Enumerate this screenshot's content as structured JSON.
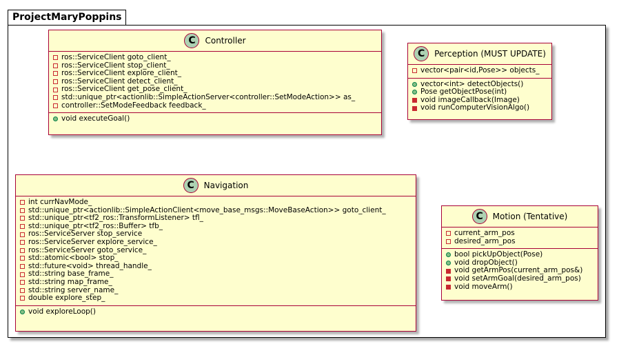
{
  "package": {
    "name": "ProjectMaryPoppins"
  },
  "classes": {
    "controller": {
      "stereotype": "C",
      "name": "Controller",
      "fields": [
        {
          "vis": "private",
          "text": "ros::ServiceClient goto_client_"
        },
        {
          "vis": "private",
          "text": "ros::ServiceClient stop_client_"
        },
        {
          "vis": "private",
          "text": "ros::ServiceClient explore_client_"
        },
        {
          "vis": "private",
          "text": "ros::ServiceClient detect_client_"
        },
        {
          "vis": "private",
          "text": "ros::ServiceClient get_pose_client_"
        },
        {
          "vis": "private",
          "text": "std::unique_ptr<actionlib::SimpleActionServer<controller::SetModeAction>> as_"
        },
        {
          "vis": "private",
          "text": "controller::SetModeFeedback feedback_"
        }
      ],
      "methods": [
        {
          "vis": "public",
          "text": "void executeGoal()"
        }
      ]
    },
    "perception": {
      "stereotype": "C",
      "name": "Perception (MUST UPDATE)",
      "fields": [
        {
          "vis": "private",
          "text": "vector<pair<id,Pose>> objects_"
        }
      ],
      "methods": [
        {
          "vis": "public",
          "text": "vector<int> detectObjects()"
        },
        {
          "vis": "public",
          "text": "Pose getObjectPose(int)"
        },
        {
          "vis": "private",
          "text": "void imageCallback(Image)"
        },
        {
          "vis": "private",
          "text": "void runComputerVisionAlgo()"
        }
      ]
    },
    "navigation": {
      "stereotype": "C",
      "name": "Navigation",
      "fields": [
        {
          "vis": "private",
          "text": "int currNavMode_"
        },
        {
          "vis": "private",
          "text": "std::unique_ptr<actionlib::SimpleActionClient<move_base_msgs::MoveBaseAction>> goto_client_"
        },
        {
          "vis": "private",
          "text": "std::unique_ptr<tf2_ros::TransformListener> tfl_"
        },
        {
          "vis": "private",
          "text": "std::unique_ptr<tf2_ros::Buffer> tfb_"
        },
        {
          "vis": "private",
          "text": "ros::ServiceServer stop_service"
        },
        {
          "vis": "private",
          "text": "ros::ServiceServer explore_service_"
        },
        {
          "vis": "private",
          "text": "ros::ServiceServer goto_service_"
        },
        {
          "vis": "private",
          "text": "std::atomic<bool> stop_"
        },
        {
          "vis": "private",
          "text": "std::future<void> thread_handle_"
        },
        {
          "vis": "private",
          "text": "std::string base_frame_"
        },
        {
          "vis": "private",
          "text": "std::string map_frame_"
        },
        {
          "vis": "private",
          "text": "std::string server_name_"
        },
        {
          "vis": "private",
          "text": "double explore_step_"
        }
      ],
      "methods": [
        {
          "vis": "public",
          "text": "void exploreLoop()"
        }
      ]
    },
    "motion": {
      "stereotype": "C",
      "name": "Motion (Tentative)",
      "fields": [
        {
          "vis": "private",
          "text": "current_arm_pos"
        },
        {
          "vis": "private",
          "text": "desired_arm_pos"
        }
      ],
      "methods": [
        {
          "vis": "public",
          "text": "bool pickUpObject(Pose)"
        },
        {
          "vis": "public",
          "text": "void dropObject()"
        },
        {
          "vis": "private",
          "text": "void getArmPos(current_arm_pos&)"
        },
        {
          "vis": "private",
          "text": "void setArmGoal(desired_arm_pos)"
        },
        {
          "vis": "private",
          "text": "void moveArm()"
        }
      ]
    }
  }
}
